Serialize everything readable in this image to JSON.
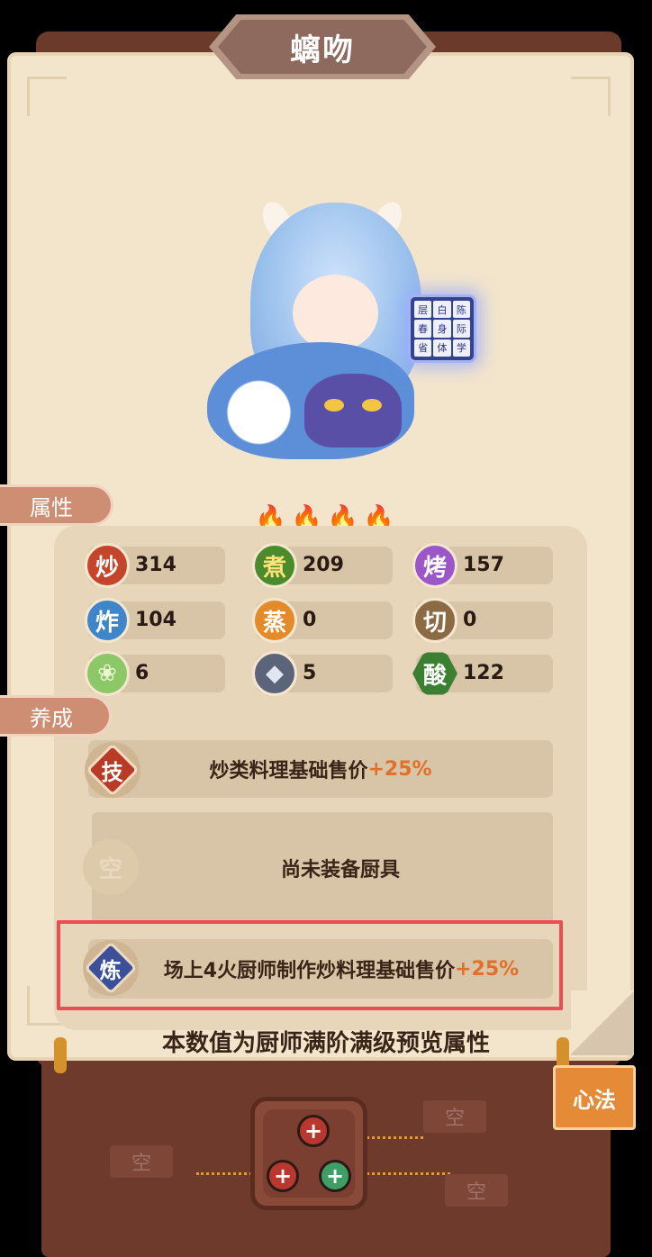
{
  "title": "螭吻",
  "cube_chars": [
    "层",
    "白",
    "陈",
    "春",
    "身",
    "际",
    "省",
    "体",
    "学"
  ],
  "tabs": {
    "attributes": "属性",
    "training": "养成"
  },
  "stats": [
    {
      "icon": "stir-fry-icon",
      "glyph": "炒",
      "value": "314"
    },
    {
      "icon": "boil-icon",
      "glyph": "煮",
      "value": "209"
    },
    {
      "icon": "roast-icon",
      "glyph": "烤",
      "value": "157"
    },
    {
      "icon": "deep-fry-icon",
      "glyph": "炸",
      "value": "104"
    },
    {
      "icon": "steam-icon",
      "glyph": "蒸",
      "value": "0"
    },
    {
      "icon": "cut-icon",
      "glyph": "切",
      "value": "0"
    },
    {
      "icon": "vegetable-icon",
      "glyph": "",
      "value": "6"
    },
    {
      "icon": "fish-icon",
      "glyph": "",
      "value": "5"
    },
    {
      "icon": "sour-icon",
      "glyph": "酸",
      "value": "122"
    }
  ],
  "skill": {
    "badge": "技",
    "text": "炒类料理基础售价",
    "bonus": "+25%"
  },
  "equipment": {
    "badge": "空",
    "text": "尚未装备厨具"
  },
  "refine": {
    "badge": "炼",
    "text": "场上4火厨师制作炒料理基础售价",
    "bonus": "+25%"
  },
  "footer_note": "本数值为厨师满阶满级预览属性",
  "xinfa_label": "心法",
  "empty_slot_label": "空",
  "colors": {
    "paper": "#f3e5cc",
    "board": "#6d3a2c",
    "accent": "#e2702a",
    "highlight": "#ee4b52"
  }
}
